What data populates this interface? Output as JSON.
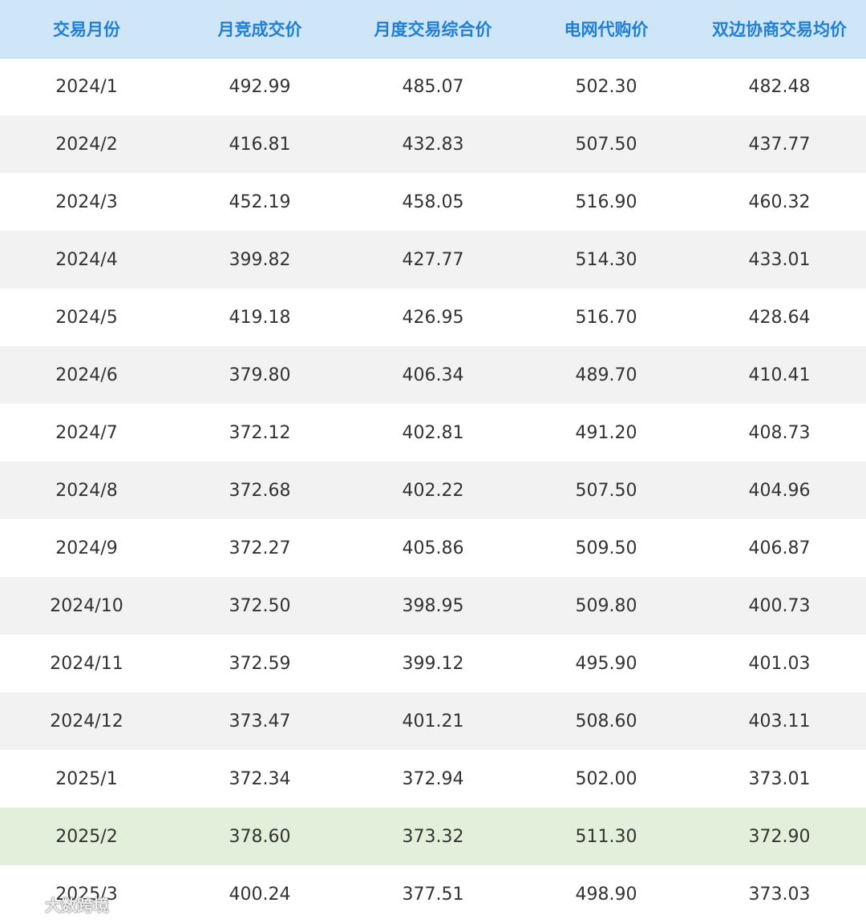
{
  "chart_data": {
    "type": "table",
    "columns": [
      "交易月份",
      "月竞成交价",
      "月度交易综合价",
      "电网代购价",
      "双边协商交易均价"
    ],
    "rows": [
      [
        "2024/1",
        "492.99",
        "485.07",
        "502.30",
        "482.48"
      ],
      [
        "2024/2",
        "416.81",
        "432.83",
        "507.50",
        "437.77"
      ],
      [
        "2024/3",
        "452.19",
        "458.05",
        "516.90",
        "460.32"
      ],
      [
        "2024/4",
        "399.82",
        "427.77",
        "514.30",
        "433.01"
      ],
      [
        "2024/5",
        "419.18",
        "426.95",
        "516.70",
        "428.64"
      ],
      [
        "2024/6",
        "379.80",
        "406.34",
        "489.70",
        "410.41"
      ],
      [
        "2024/7",
        "372.12",
        "402.81",
        "491.20",
        "408.73"
      ],
      [
        "2024/8",
        "372.68",
        "402.22",
        "507.50",
        "404.96"
      ],
      [
        "2024/9",
        "372.27",
        "405.86",
        "509.50",
        "406.87"
      ],
      [
        "2024/10",
        "372.50",
        "398.95",
        "509.80",
        "400.73"
      ],
      [
        "2024/11",
        "372.59",
        "399.12",
        "495.90",
        "401.03"
      ],
      [
        "2024/12",
        "373.47",
        "401.21",
        "508.60",
        "403.11"
      ],
      [
        "2025/1",
        "372.34",
        "372.94",
        "502.00",
        "373.01"
      ],
      [
        "2025/2",
        "378.60",
        "373.32",
        "511.30",
        "372.90"
      ],
      [
        "2025/3",
        "400.24",
        "377.51",
        "498.90",
        "373.03"
      ]
    ],
    "highlighted_row": "2025/2",
    "colors": {
      "header_bg": "#cfe5f8",
      "header_text": "#1f7fd6",
      "row_alt_bg": "#f2f2f2",
      "row_highlight_bg": "#e2efda",
      "cell_text": "#333333"
    }
  },
  "watermark": {
    "text": "大数跨境",
    "icon": "logo-icon"
  }
}
